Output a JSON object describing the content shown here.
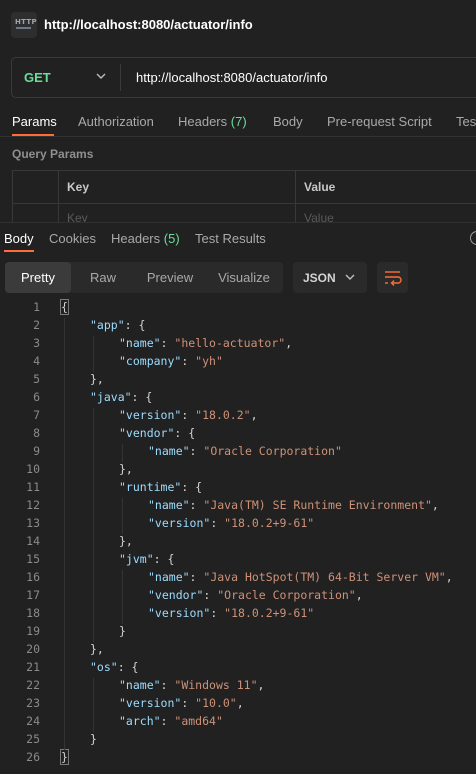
{
  "request": {
    "title": "http://localhost:8080/actuator/info",
    "method": "GET",
    "url": "http://localhost:8080/actuator/info",
    "tabs": [
      {
        "label": "Params",
        "count": ""
      },
      {
        "label": "Authorization",
        "count": ""
      },
      {
        "label": "Headers",
        "count": "(7)"
      },
      {
        "label": "Body",
        "count": ""
      },
      {
        "label": "Pre-request Script",
        "count": ""
      },
      {
        "label": "Tests",
        "count": ""
      }
    ],
    "query_params": {
      "title": "Query Params",
      "headers": [
        "Key",
        "Value"
      ],
      "placeholders": [
        "Key",
        "Value"
      ]
    }
  },
  "response": {
    "tabs": [
      {
        "label": "Body",
        "count": ""
      },
      {
        "label": "Cookies",
        "count": ""
      },
      {
        "label": "Headers",
        "count": "(5)"
      },
      {
        "label": "Test Results",
        "count": ""
      }
    ],
    "formats": [
      "Pretty",
      "Raw",
      "Preview",
      "Visualize"
    ],
    "language": "JSON",
    "lines": [
      {
        "n": "1",
        "indent": 0,
        "parts": [
          [
            "p",
            "{"
          ]
        ]
      },
      {
        "n": "2",
        "indent": 1,
        "parts": [
          [
            "k",
            "\"app\""
          ],
          [
            "p",
            ": {"
          ]
        ]
      },
      {
        "n": "3",
        "indent": 2,
        "parts": [
          [
            "k",
            "\"name\""
          ],
          [
            "p",
            ": "
          ],
          [
            "s",
            "\"hello-actuator\""
          ],
          [
            "p",
            ","
          ]
        ]
      },
      {
        "n": "4",
        "indent": 2,
        "parts": [
          [
            "k",
            "\"company\""
          ],
          [
            "p",
            ": "
          ],
          [
            "s",
            "\"yh\""
          ]
        ]
      },
      {
        "n": "5",
        "indent": 1,
        "parts": [
          [
            "p",
            "},"
          ]
        ]
      },
      {
        "n": "6",
        "indent": 1,
        "parts": [
          [
            "k",
            "\"java\""
          ],
          [
            "p",
            ": {"
          ]
        ]
      },
      {
        "n": "7",
        "indent": 2,
        "parts": [
          [
            "k",
            "\"version\""
          ],
          [
            "p",
            ": "
          ],
          [
            "s",
            "\"18.0.2\""
          ],
          [
            "p",
            ","
          ]
        ]
      },
      {
        "n": "8",
        "indent": 2,
        "parts": [
          [
            "k",
            "\"vendor\""
          ],
          [
            "p",
            ": {"
          ]
        ]
      },
      {
        "n": "9",
        "indent": 3,
        "parts": [
          [
            "k",
            "\"name\""
          ],
          [
            "p",
            ": "
          ],
          [
            "s",
            "\"Oracle Corporation\""
          ]
        ]
      },
      {
        "n": "10",
        "indent": 2,
        "parts": [
          [
            "p",
            "},"
          ]
        ]
      },
      {
        "n": "11",
        "indent": 2,
        "parts": [
          [
            "k",
            "\"runtime\""
          ],
          [
            "p",
            ": {"
          ]
        ]
      },
      {
        "n": "12",
        "indent": 3,
        "parts": [
          [
            "k",
            "\"name\""
          ],
          [
            "p",
            ": "
          ],
          [
            "s",
            "\"Java(TM) SE Runtime Environment\""
          ],
          [
            "p",
            ","
          ]
        ]
      },
      {
        "n": "13",
        "indent": 3,
        "parts": [
          [
            "k",
            "\"version\""
          ],
          [
            "p",
            ": "
          ],
          [
            "s",
            "\"18.0.2+9-61\""
          ]
        ]
      },
      {
        "n": "14",
        "indent": 2,
        "parts": [
          [
            "p",
            "},"
          ]
        ]
      },
      {
        "n": "15",
        "indent": 2,
        "parts": [
          [
            "k",
            "\"jvm\""
          ],
          [
            "p",
            ": {"
          ]
        ]
      },
      {
        "n": "16",
        "indent": 3,
        "parts": [
          [
            "k",
            "\"name\""
          ],
          [
            "p",
            ": "
          ],
          [
            "s",
            "\"Java HotSpot(TM) 64-Bit Server VM\""
          ],
          [
            "p",
            ","
          ]
        ]
      },
      {
        "n": "17",
        "indent": 3,
        "parts": [
          [
            "k",
            "\"vendor\""
          ],
          [
            "p",
            ": "
          ],
          [
            "s",
            "\"Oracle Corporation\""
          ],
          [
            "p",
            ","
          ]
        ]
      },
      {
        "n": "18",
        "indent": 3,
        "parts": [
          [
            "k",
            "\"version\""
          ],
          [
            "p",
            ": "
          ],
          [
            "s",
            "\"18.0.2+9-61\""
          ]
        ]
      },
      {
        "n": "19",
        "indent": 2,
        "parts": [
          [
            "p",
            "}"
          ]
        ]
      },
      {
        "n": "20",
        "indent": 1,
        "parts": [
          [
            "p",
            "},"
          ]
        ]
      },
      {
        "n": "21",
        "indent": 1,
        "parts": [
          [
            "k",
            "\"os\""
          ],
          [
            "p",
            ": {"
          ]
        ]
      },
      {
        "n": "22",
        "indent": 2,
        "parts": [
          [
            "k",
            "\"name\""
          ],
          [
            "p",
            ": "
          ],
          [
            "s",
            "\"Windows 11\""
          ],
          [
            "p",
            ","
          ]
        ]
      },
      {
        "n": "23",
        "indent": 2,
        "parts": [
          [
            "k",
            "\"version\""
          ],
          [
            "p",
            ": "
          ],
          [
            "s",
            "\"10.0\""
          ],
          [
            "p",
            ","
          ]
        ]
      },
      {
        "n": "24",
        "indent": 2,
        "parts": [
          [
            "k",
            "\"arch\""
          ],
          [
            "p",
            ": "
          ],
          [
            "s",
            "\"amd64\""
          ]
        ]
      },
      {
        "n": "25",
        "indent": 1,
        "parts": [
          [
            "p",
            "}"
          ]
        ]
      },
      {
        "n": "26",
        "indent": 0,
        "parts": [
          [
            "p",
            "}"
          ]
        ]
      }
    ]
  },
  "colors": {
    "accent": "#ff6c37",
    "method_get": "#6bdd9a",
    "json_key": "#9cdcfe",
    "json_string": "#ce9178",
    "background": "#212121"
  },
  "icons": {
    "request_type": "http-icon",
    "method_dropdown": "chevron-down-icon",
    "language_dropdown": "chevron-down-icon",
    "wrap": "wrap-lines-icon"
  }
}
